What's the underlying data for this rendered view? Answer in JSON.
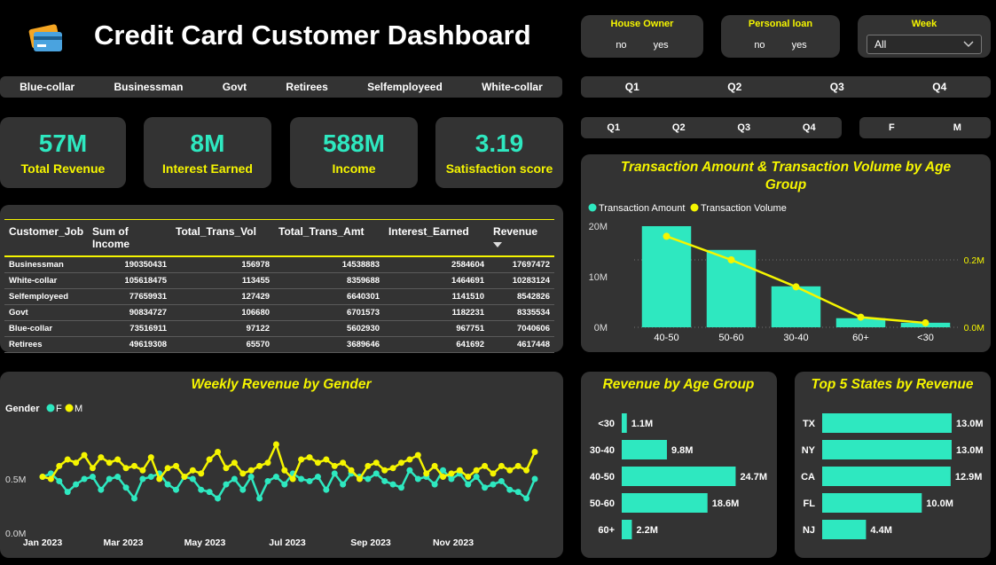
{
  "header": {
    "title": "Credit Card Customer Dashboard",
    "logo_icon": "credit-card-icon"
  },
  "slicers": {
    "house_owner": {
      "title": "House Owner",
      "options": [
        "no",
        "yes"
      ]
    },
    "personal_loan": {
      "title": "Personal loan",
      "options": [
        "no",
        "yes"
      ]
    },
    "week": {
      "title": "Week",
      "selected": "All"
    },
    "jobs": [
      "Blue-collar",
      "Businessman",
      "Govt",
      "Retirees",
      "Selfemployeed",
      "White-collar"
    ],
    "quarters_top": [
      "Q1",
      "Q2",
      "Q3",
      "Q4"
    ],
    "quarters_mid": [
      "Q1",
      "Q2",
      "Q3",
      "Q4"
    ],
    "gender": [
      "F",
      "M"
    ]
  },
  "kpis": [
    {
      "value": "57M",
      "label": "Total Revenue"
    },
    {
      "value": "8M",
      "label": "Interest Earned"
    },
    {
      "value": "588M",
      "label": "Income"
    },
    {
      "value": "3.19",
      "label": "Satisfaction score"
    }
  ],
  "table": {
    "columns": [
      "Customer_Job",
      "Sum of Income",
      "Total_Trans_Vol",
      "Total_Trans_Amt",
      "Interest_Earned",
      "Revenue"
    ],
    "rows": [
      [
        "Businessman",
        "190350431",
        "156978",
        "14538883",
        "2584604",
        "17697472"
      ],
      [
        "White-collar",
        "105618475",
        "113455",
        "8359688",
        "1464691",
        "10283124"
      ],
      [
        "Selfemployeed",
        "77659931",
        "127429",
        "6640301",
        "1141510",
        "8542826"
      ],
      [
        "Govt",
        "90834727",
        "106680",
        "6701573",
        "1182231",
        "8335534"
      ],
      [
        "Blue-collar",
        "73516911",
        "97122",
        "5602930",
        "967751",
        "7040606"
      ],
      [
        "Retirees",
        "49619308",
        "65570",
        "3689646",
        "641692",
        "4617448"
      ]
    ]
  },
  "chart_data": [
    {
      "type": "bar",
      "title": "Transaction Amount & Transaction Volume by Age Group",
      "categories": [
        "40-50",
        "50-60",
        "30-40",
        "60+",
        "<30"
      ],
      "series": [
        {
          "name": "Transaction Amount",
          "values": [
            20000000,
            15300000,
            8100000,
            1800000,
            900000
          ],
          "color": "#2ee8c0"
        },
        {
          "name": "Transaction Volume",
          "values": [
            0.27,
            0.2,
            0.12,
            0.03,
            0.013
          ],
          "color": "#f5f500"
        }
      ],
      "y_ticks": [
        "0M",
        "10M",
        "20M"
      ],
      "y2_ticks": [
        "0.0M",
        "0.2M"
      ],
      "ylim": [
        0,
        20000000
      ],
      "y2lim": [
        0,
        0.3
      ]
    },
    {
      "type": "line",
      "title": "Weekly Revenue by Gender",
      "legend_title": "Gender",
      "x_ticks": [
        "Jan 2023",
        "Mar 2023",
        "May 2023",
        "Jul 2023",
        "Sep 2023",
        "Nov 2023"
      ],
      "y_ticks": [
        "0.0M",
        "0.5M"
      ],
      "ylim": [
        0,
        1
      ],
      "series": [
        {
          "name": "F",
          "color": "#2ee8c0",
          "values": [
            0.52,
            0.55,
            0.48,
            0.38,
            0.45,
            0.5,
            0.52,
            0.4,
            0.5,
            0.52,
            0.42,
            0.32,
            0.5,
            0.52,
            0.55,
            0.45,
            0.4,
            0.52,
            0.5,
            0.4,
            0.38,
            0.32,
            0.45,
            0.5,
            0.4,
            0.52,
            0.32,
            0.48,
            0.52,
            0.45,
            0.55,
            0.5,
            0.48,
            0.52,
            0.4,
            0.55,
            0.45,
            0.55,
            0.52,
            0.5,
            0.55,
            0.48,
            0.45,
            0.42,
            0.58,
            0.5,
            0.52,
            0.45,
            0.58,
            0.5,
            0.55,
            0.45,
            0.52,
            0.42,
            0.45,
            0.48,
            0.4,
            0.38,
            0.32,
            0.5
          ]
        },
        {
          "name": "M",
          "color": "#f5f500",
          "values": [
            0.52,
            0.5,
            0.62,
            0.68,
            0.65,
            0.72,
            0.6,
            0.7,
            0.65,
            0.68,
            0.6,
            0.62,
            0.58,
            0.7,
            0.5,
            0.6,
            0.62,
            0.52,
            0.58,
            0.55,
            0.68,
            0.75,
            0.6,
            0.65,
            0.55,
            0.58,
            0.62,
            0.65,
            0.82,
            0.58,
            0.5,
            0.68,
            0.7,
            0.65,
            0.68,
            0.62,
            0.65,
            0.58,
            0.5,
            0.62,
            0.65,
            0.58,
            0.6,
            0.65,
            0.68,
            0.72,
            0.55,
            0.62,
            0.52,
            0.55,
            0.58,
            0.52,
            0.58,
            0.62,
            0.55,
            0.62,
            0.58,
            0.62,
            0.58,
            0.75
          ]
        }
      ]
    },
    {
      "type": "bar",
      "orientation": "horizontal",
      "title": "Revenue by Age Group",
      "categories": [
        "<30",
        "30-40",
        "40-50",
        "50-60",
        "60+"
      ],
      "values": [
        1.1,
        9.8,
        24.7,
        18.6,
        2.2
      ],
      "labels": [
        "1.1M",
        "9.8M",
        "24.7M",
        "18.6M",
        "2.2M"
      ],
      "xlim": [
        0,
        25
      ]
    },
    {
      "type": "bar",
      "orientation": "horizontal",
      "title": "Top 5 States by Revenue",
      "categories": [
        "TX",
        "NY",
        "CA",
        "FL",
        "NJ"
      ],
      "values": [
        13.0,
        13.0,
        12.9,
        10.0,
        4.4
      ],
      "labels": [
        "13.0M",
        "13.0M",
        "12.9M",
        "10.0M",
        "4.4M"
      ],
      "xlim": [
        0,
        13
      ]
    }
  ],
  "colors": {
    "accent": "#2ee8c0",
    "highlight": "#f5f500",
    "panel": "#333333",
    "background": "#000000"
  },
  "icons": {
    "dropdown": "chevron-down-icon",
    "sort": "sort-desc-icon"
  }
}
